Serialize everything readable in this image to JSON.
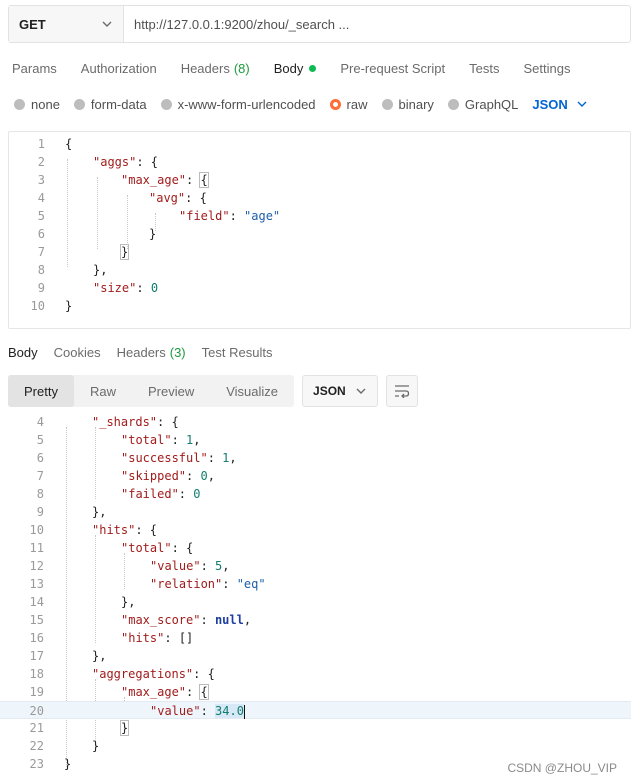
{
  "request": {
    "method": "GET",
    "url": "http://127.0.0.1:9200/zhou/_search ..."
  },
  "req_tabs": {
    "params": "Params",
    "authorization": "Authorization",
    "headers": "Headers",
    "headers_count": "(8)",
    "body": "Body",
    "prerequest": "Pre-request Script",
    "tests": "Tests",
    "settings": "Settings"
  },
  "body_types": {
    "none": "none",
    "form_data": "form-data",
    "urlencoded": "x-www-form-urlencoded",
    "raw": "raw",
    "binary": "binary",
    "graphql": "GraphQL",
    "json": "JSON"
  },
  "request_body": {
    "l1": "1",
    "l2": "2",
    "l3": "3",
    "l4": "4",
    "l5": "5",
    "l6": "6",
    "l7": "7",
    "l8": "8",
    "l9": "9",
    "l10": "10",
    "open": "{",
    "aggs_key": "\"aggs\"",
    "max_age_key": "\"max_age\"",
    "avg_key": "\"avg\"",
    "field_key": "\"field\"",
    "field_val": "\"age\"",
    "size_key": "\"size\"",
    "size_val": "0",
    "close": "}"
  },
  "res_tabs": {
    "body": "Body",
    "cookies": "Cookies",
    "headers": "Headers",
    "headers_count": "(3)",
    "test_results": "Test Results"
  },
  "view": {
    "pretty": "Pretty",
    "raw": "Raw",
    "preview": "Preview",
    "visualize": "Visualize",
    "format": "JSON"
  },
  "response_body": {
    "l4": "4",
    "l5": "5",
    "l6": "6",
    "l7": "7",
    "l8": "8",
    "l9": "9",
    "l10": "10",
    "l11": "11",
    "l12": "12",
    "l13": "13",
    "l14": "14",
    "l15": "15",
    "l16": "16",
    "l17": "17",
    "l18": "18",
    "l19": "19",
    "l20": "20",
    "l21": "21",
    "l22": "22",
    "l23": "23",
    "shards_key": "\"_shards\"",
    "total_key": "\"total\"",
    "total_val": "1",
    "successful_key": "\"successful\"",
    "successful_val": "1",
    "skipped_key": "\"skipped\"",
    "skipped_val": "0",
    "failed_key": "\"failed\"",
    "failed_val": "0",
    "hits_key": "\"hits\"",
    "value_key": "\"value\"",
    "value_val": "5",
    "relation_key": "\"relation\"",
    "relation_val": "\"eq\"",
    "max_score_key": "\"max_score\"",
    "max_score_val": "null",
    "hits_arr_key": "\"hits\"",
    "hits_arr_val": "[]",
    "aggregations_key": "\"aggregations\"",
    "max_age_key": "\"max_age\"",
    "agg_value_key": "\"value\"",
    "agg_value_val": "34.0"
  },
  "watermark": "CSDN @ZHOU_VIP"
}
